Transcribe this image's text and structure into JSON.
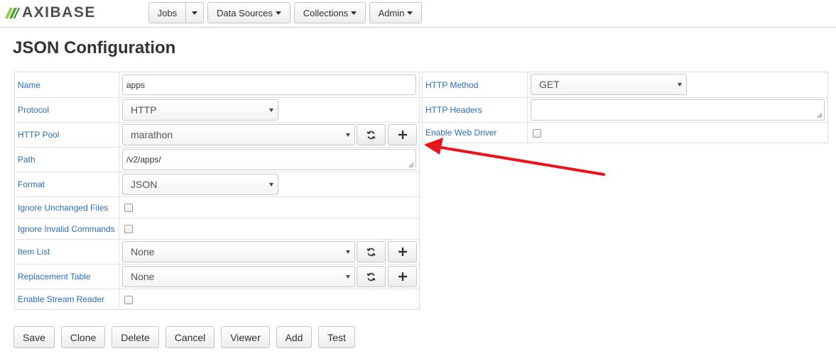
{
  "brand": {
    "name": "AXIBASE",
    "logo_icon": "axibase-logo-icon"
  },
  "nav": {
    "jobs": "Jobs",
    "data_sources": "Data Sources",
    "collections": "Collections",
    "admin": "Admin"
  },
  "page_title": "JSON Configuration",
  "left_form": {
    "name": {
      "label": "Name",
      "value": "apps"
    },
    "protocol": {
      "label": "Protocol",
      "value": "HTTP"
    },
    "http_pool": {
      "label": "HTTP Pool",
      "value": "marathon"
    },
    "path": {
      "label": "Path",
      "value": "/v2/apps/"
    },
    "format": {
      "label": "Format",
      "value": "JSON"
    },
    "ignore_unchanged": {
      "label": "Ignore Unchanged Files",
      "checked": false
    },
    "ignore_invalid": {
      "label": "Ignore Invalid Commands",
      "checked": false
    },
    "item_list": {
      "label": "Item List",
      "value": "None"
    },
    "replacement_table": {
      "label": "Replacement Table",
      "value": "None"
    },
    "enable_stream_reader": {
      "label": "Enable Stream Reader",
      "checked": false
    }
  },
  "right_form": {
    "http_method": {
      "label": "HTTP Method",
      "value": "GET"
    },
    "http_headers": {
      "label": "HTTP Headers",
      "value": ""
    },
    "enable_web_driver": {
      "label": "Enable Web Driver",
      "checked": false
    }
  },
  "actions": {
    "save": "Save",
    "clone": "Clone",
    "delete": "Delete",
    "cancel": "Cancel",
    "viewer": "Viewer",
    "add": "Add",
    "test": "Test"
  },
  "colors": {
    "label_link": "#2a6ebb",
    "annotation_arrow": "#e8141b"
  }
}
